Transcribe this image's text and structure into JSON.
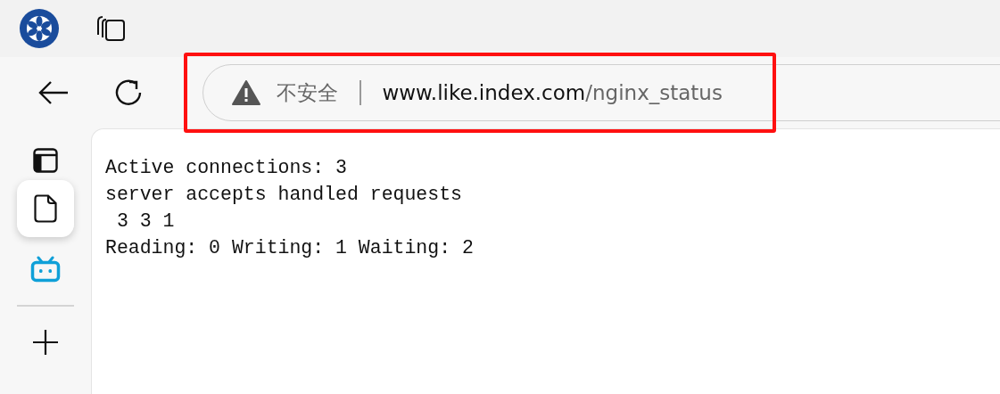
{
  "url_bar": {
    "security_label": "不安全",
    "domain": "www.like.index.com",
    "path": "/nginx_status",
    "highlighted": true
  },
  "vertical_tabs": [
    {
      "kind": "document",
      "selected": true
    },
    {
      "kind": "tv",
      "selected": false
    }
  ],
  "page_lines": [
    "Active connections: 3",
    "server accepts handled requests",
    " 3 3 1",
    "Reading: 0 Writing: 1 Waiting: 2"
  ]
}
